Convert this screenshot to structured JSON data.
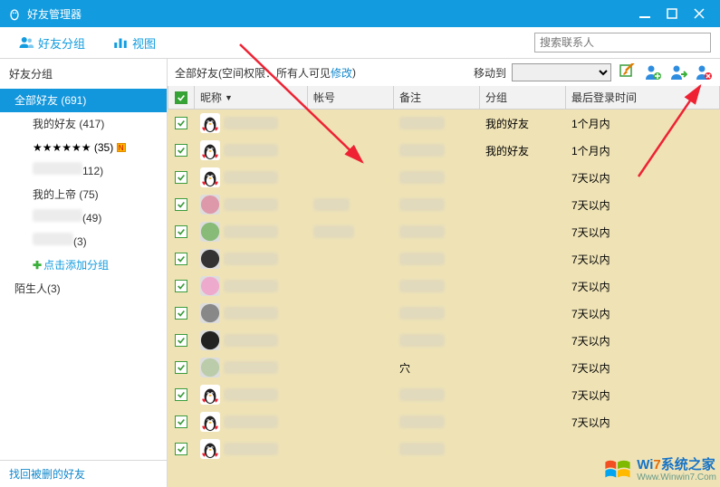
{
  "titlebar": {
    "title": "好友管理器"
  },
  "toolbar": {
    "group_btn": "好友分组",
    "view_btn": "视图",
    "search_placeholder": "搜索联系人"
  },
  "sidebar": {
    "header": "好友分组",
    "items": [
      {
        "label": "全部好友 (691)",
        "selected": true,
        "name": "group-all"
      },
      {
        "label": "我的好友 (417)",
        "child": true,
        "name": "group-myfriends"
      },
      {
        "label": "★★★★★★ (35)",
        "child": true,
        "starred": true,
        "newdot": true,
        "name": "group-starred"
      },
      {
        "label": "112)",
        "child": true,
        "blur_prefix": 55,
        "name": "group-blur1"
      },
      {
        "label": "我的上帝 (75)",
        "child": true,
        "name": "group-mygod"
      },
      {
        "label": "(49)",
        "child": true,
        "blur_prefix": 55,
        "name": "group-blur2"
      },
      {
        "label": "(3)",
        "child": true,
        "blur_prefix": 45,
        "name": "group-blur3"
      },
      {
        "label": "点击添加分组",
        "child": true,
        "add": true,
        "name": "group-add"
      },
      {
        "label": "陌生人(3)",
        "name": "group-stranger"
      }
    ],
    "footer_link": "找回被删的好友"
  },
  "content_header": {
    "title_prefix": "全部好友",
    "perm_label": "(空间权限：所有人可见 ",
    "perm_link": "修改",
    "perm_suffix": ")",
    "move_to": "移动到"
  },
  "columns": {
    "nick": "昵称",
    "acct": "帐号",
    "remark": "备注",
    "group": "分组",
    "last": "最后登录时间"
  },
  "rows": [
    {
      "avatar": "penguin",
      "group": "我的好友",
      "last": "1个月内"
    },
    {
      "avatar": "penguin",
      "group": "我的好友",
      "last": "1个月内"
    },
    {
      "avatar": "penguin",
      "group": "",
      "last": "7天以内"
    },
    {
      "avatar": "round1",
      "acct_hint": 40,
      "group": "",
      "last": "7天以内"
    },
    {
      "avatar": "round2",
      "acct_hint": 45,
      "group": "",
      "last": "7天以内"
    },
    {
      "avatar": "dark",
      "group": "",
      "last": "7天以内"
    },
    {
      "avatar": "pink",
      "group": "",
      "last": "7天以内"
    },
    {
      "avatar": "mono",
      "group": "",
      "last": "7天以内"
    },
    {
      "avatar": "dark2",
      "group": "",
      "last": "7天以内"
    },
    {
      "avatar": "round3",
      "remark_text": "穴",
      "group": "",
      "last": "7天以内"
    },
    {
      "avatar": "penguin",
      "group": "",
      "last": "7天以内"
    },
    {
      "avatar": "penguin",
      "group": "",
      "last": "7天以内"
    },
    {
      "avatar": "penguin",
      "group": "",
      "last": ""
    }
  ],
  "watermark": {
    "l1a": "Wi",
    "l1b": "7",
    "l1c": "系统之家",
    "l2": "Www.Winwin7.Com"
  }
}
